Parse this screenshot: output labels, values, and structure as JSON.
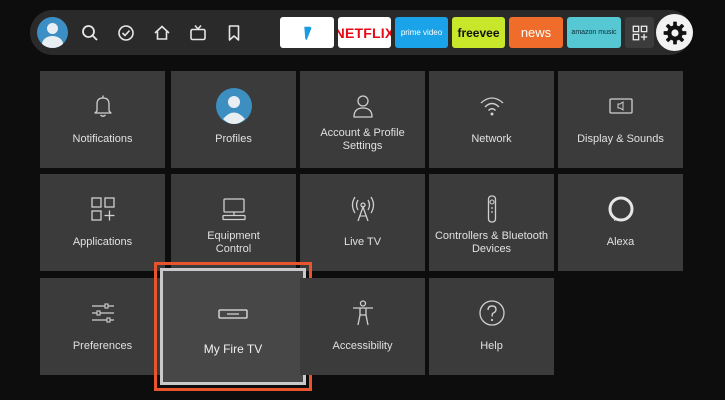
{
  "apps": {
    "netflix": "NETFLIX",
    "prime": "prime video",
    "freevee": "freevee",
    "news": "news",
    "music": "amazon music"
  },
  "settings": {
    "notifications": "Notifications",
    "profiles": "Profiles",
    "account_line1": "Account & Profile",
    "account_line2": "Settings",
    "network": "Network",
    "display": "Display & Sounds",
    "applications": "Applications",
    "equipment_line1": "Equipment",
    "equipment_line2": "Control",
    "livetv": "Live TV",
    "controllers_line1": "Controllers & Bluetooth",
    "controllers_line2": "Devices",
    "alexa": "Alexa",
    "preferences": "Preferences",
    "myfiretv": "My Fire TV",
    "accessibility": "Accessibility",
    "help": "Help"
  },
  "colors": {
    "focus_outline": "#e8542c",
    "prime": "#1aa3e8",
    "freevee": "#c8e62a",
    "news": "#ef6c2a",
    "music": "#55c8d4",
    "netflix": "#e50914"
  }
}
